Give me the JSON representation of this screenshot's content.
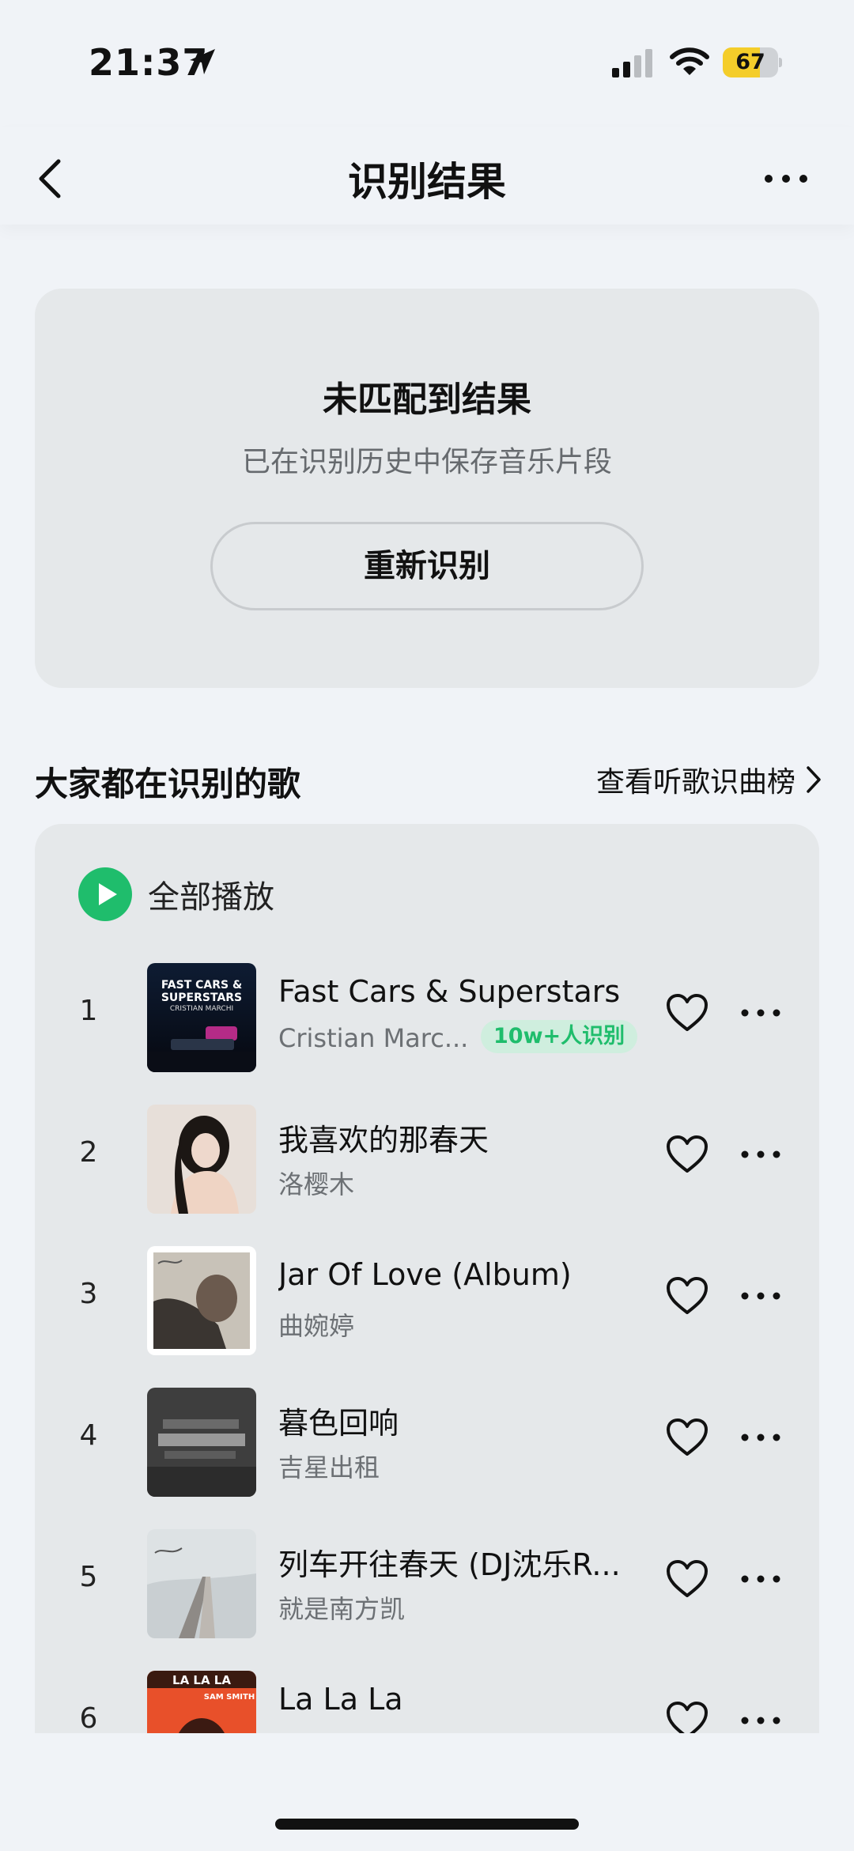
{
  "status_bar": {
    "time": "21:37",
    "battery": "67",
    "battery_level": 0.67
  },
  "nav": {
    "title": "识别结果"
  },
  "no_match": {
    "title": "未匹配到结果",
    "subtitle": "已在识别历史中保存音乐片段",
    "retry_label": "重新识别"
  },
  "section": {
    "title": "大家都在识别的歌",
    "link_label": "查看听歌识曲榜"
  },
  "play_all_label": "全部播放",
  "songs": [
    {
      "rank": "1",
      "title": "Fast Cars & Superstars",
      "artist": "Cristian Marc...",
      "badge": "10w+人识别"
    },
    {
      "rank": "2",
      "title": "我喜欢的那春天",
      "artist": "洛樱木"
    },
    {
      "rank": "3",
      "title": "Jar Of Love (Album)",
      "artist": "曲婉婷"
    },
    {
      "rank": "4",
      "title": "暮色回响",
      "artist": "吉星出租"
    },
    {
      "rank": "5",
      "title": "列车开往春天 (DJ沈乐R...",
      "artist": "就是南方凯"
    },
    {
      "rank": "6",
      "title": "La La La",
      "artist": ""
    }
  ],
  "cover_texts": {
    "cover1_line1": "FAST CARS &",
    "cover1_line2": "SUPERSTARS",
    "cover1_line3": "CRISTIAN MARCHI",
    "cover6_line1": "LA LA LA",
    "cover6_line2": "SAM SMITH"
  },
  "colors": {
    "accent_green": "#1fbd6c",
    "battery_yellow": "#f4cd2a",
    "card_bg": "#e5e8ea"
  }
}
